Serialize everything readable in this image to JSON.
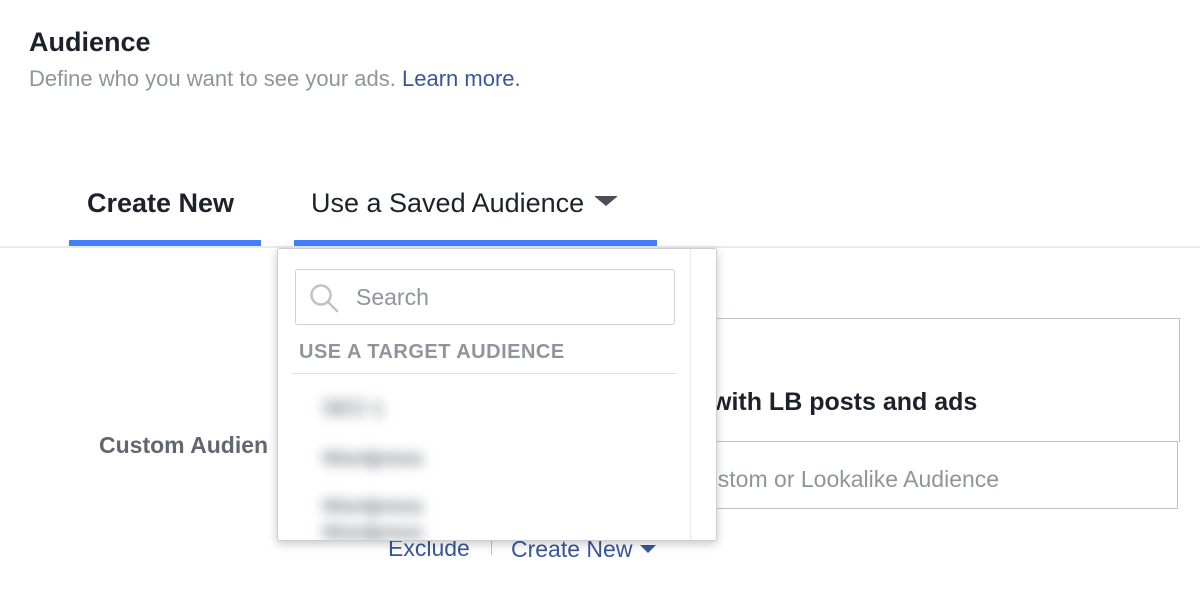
{
  "header": {
    "title": "Audience",
    "subtitle": "Define who you want to see your ads. ",
    "learn_more": "Learn more."
  },
  "tabs": {
    "create_new": "Create New",
    "saved_audience": "Use a Saved Audience"
  },
  "colors": {
    "accent": "#4080ff",
    "link": "#365899",
    "muted": "#90949c"
  },
  "form": {
    "custom_audience_label": "Custom Audien",
    "box_text": "with LB posts and ads",
    "input_placeholder": "ustom or Lookalike Audience",
    "exclude_link": "Exclude",
    "create_new_link": "Create New"
  },
  "dropdown": {
    "search_placeholder": "Search",
    "search_icon": "search-icon",
    "heading": "USE A TARGET AUDIENCE",
    "items": [
      "SEO 1",
      "Wordpress",
      "Wordpress",
      "Wordpress"
    ]
  }
}
